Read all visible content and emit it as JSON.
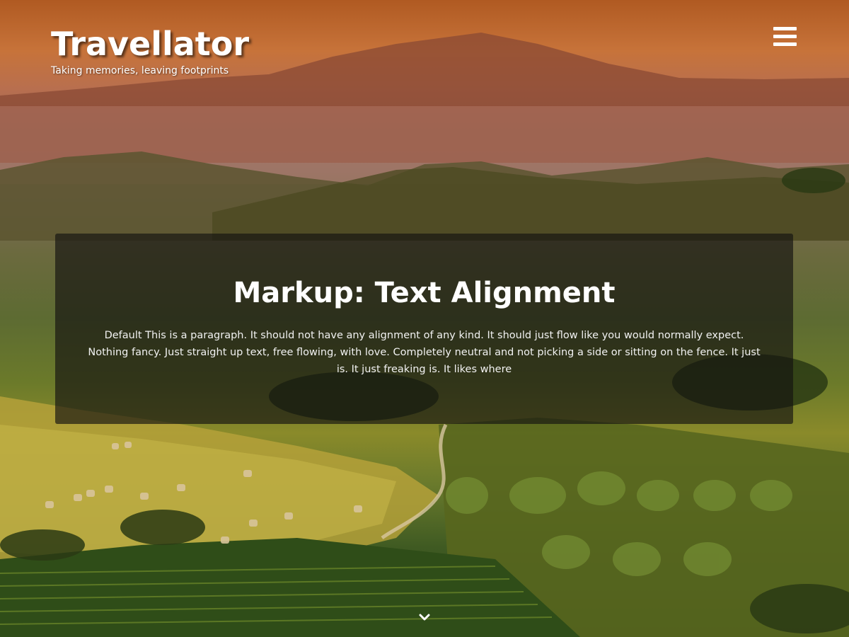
{
  "site": {
    "title": "Travellator",
    "tagline": "Taking memories, leaving footprints"
  },
  "header": {
    "menu_icon": "hamburger-menu-icon"
  },
  "post": {
    "title": "Markup: Text Alignment",
    "excerpt": "Default This is a paragraph. It should not have any alignment of any kind. It should just flow like you would normally expect. Nothing fancy. Just straight up text, free flowing, with love. Completely neutral and not picking a side or sitting on the fence. It just is. It just freaking is. It likes where"
  },
  "footer": {
    "scroll_icon": "chevron-down-icon"
  },
  "colors": {
    "sky_top": "#b05a22",
    "card_overlay": "rgba(20,18,16,0.66)",
    "text": "#ffffff"
  }
}
